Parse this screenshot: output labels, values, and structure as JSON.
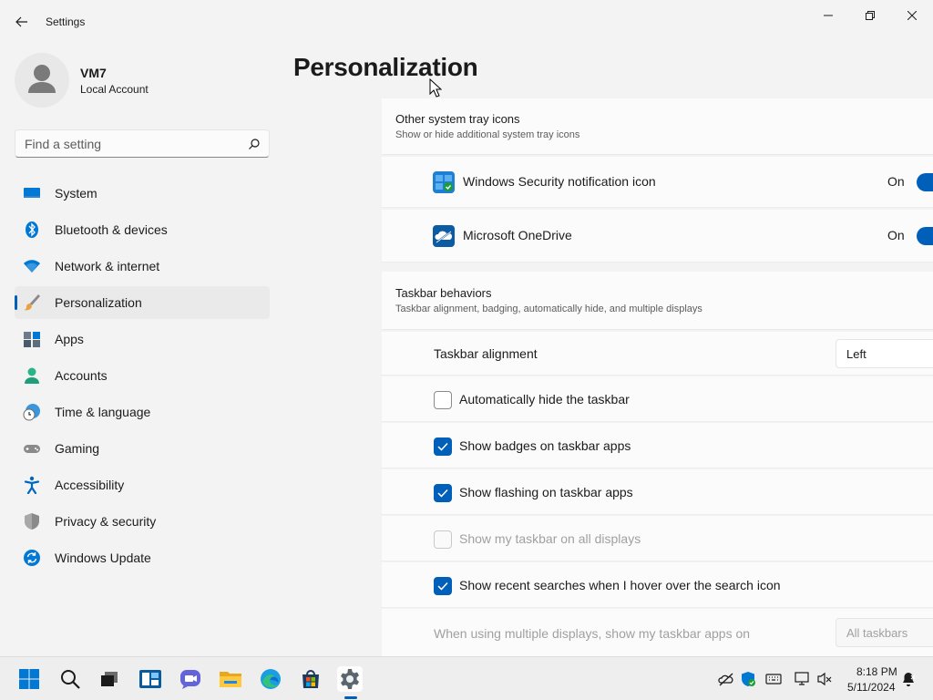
{
  "window": {
    "title": "Settings",
    "back_icon": "back-arrow-icon",
    "controls": [
      "minimize-icon",
      "restore-icon",
      "close-icon"
    ]
  },
  "account": {
    "name": "VM7",
    "type": "Local Account"
  },
  "search": {
    "placeholder": "Find a setting"
  },
  "nav": {
    "items": [
      {
        "label": "System",
        "icon": "system-icon"
      },
      {
        "label": "Bluetooth & devices",
        "icon": "bluetooth-icon"
      },
      {
        "label": "Network & internet",
        "icon": "wifi-icon"
      },
      {
        "label": "Personalization",
        "icon": "brush-icon",
        "active": true
      },
      {
        "label": "Apps",
        "icon": "apps-icon"
      },
      {
        "label": "Accounts",
        "icon": "accounts-icon"
      },
      {
        "label": "Time & language",
        "icon": "time-language-icon"
      },
      {
        "label": "Gaming",
        "icon": "gamepad-icon"
      },
      {
        "label": "Accessibility",
        "icon": "accessibility-icon"
      },
      {
        "label": "Privacy & security",
        "icon": "shield-icon"
      },
      {
        "label": "Windows Update",
        "icon": "update-icon"
      }
    ]
  },
  "page": {
    "title": "Personalization"
  },
  "tray_section": {
    "title": "Other system tray icons",
    "subtitle": "Show or hide additional system tray icons",
    "items": [
      {
        "label": "Windows Security notification icon",
        "state": "On",
        "icon": "windows-security-icon"
      },
      {
        "label": "Microsoft OneDrive",
        "state": "On",
        "icon": "onedrive-icon"
      }
    ]
  },
  "behaviors_section": {
    "title": "Taskbar behaviors",
    "subtitle": "Taskbar alignment, badging, automatically hide, and multiple displays",
    "alignment": {
      "label": "Taskbar alignment",
      "value": "Left"
    },
    "checkboxes": [
      {
        "label": "Automatically hide the taskbar",
        "checked": false,
        "disabled": false
      },
      {
        "label": "Show badges on taskbar apps",
        "checked": true,
        "disabled": false
      },
      {
        "label": "Show flashing on taskbar apps",
        "checked": true,
        "disabled": false
      },
      {
        "label": "Show my taskbar on all displays",
        "checked": false,
        "disabled": true
      },
      {
        "label": "Show recent searches when I hover over the search icon",
        "checked": true,
        "disabled": false
      }
    ],
    "multi_display": {
      "label": "When using multiple displays, show my taskbar apps on",
      "value": "All taskbars"
    }
  },
  "taskbar": {
    "clock_time": "8:18 PM",
    "clock_date": "5/11/2024"
  },
  "colors": {
    "accent": "#005fb8",
    "background": "#f3f3f3",
    "card": "#fbfbfb"
  }
}
